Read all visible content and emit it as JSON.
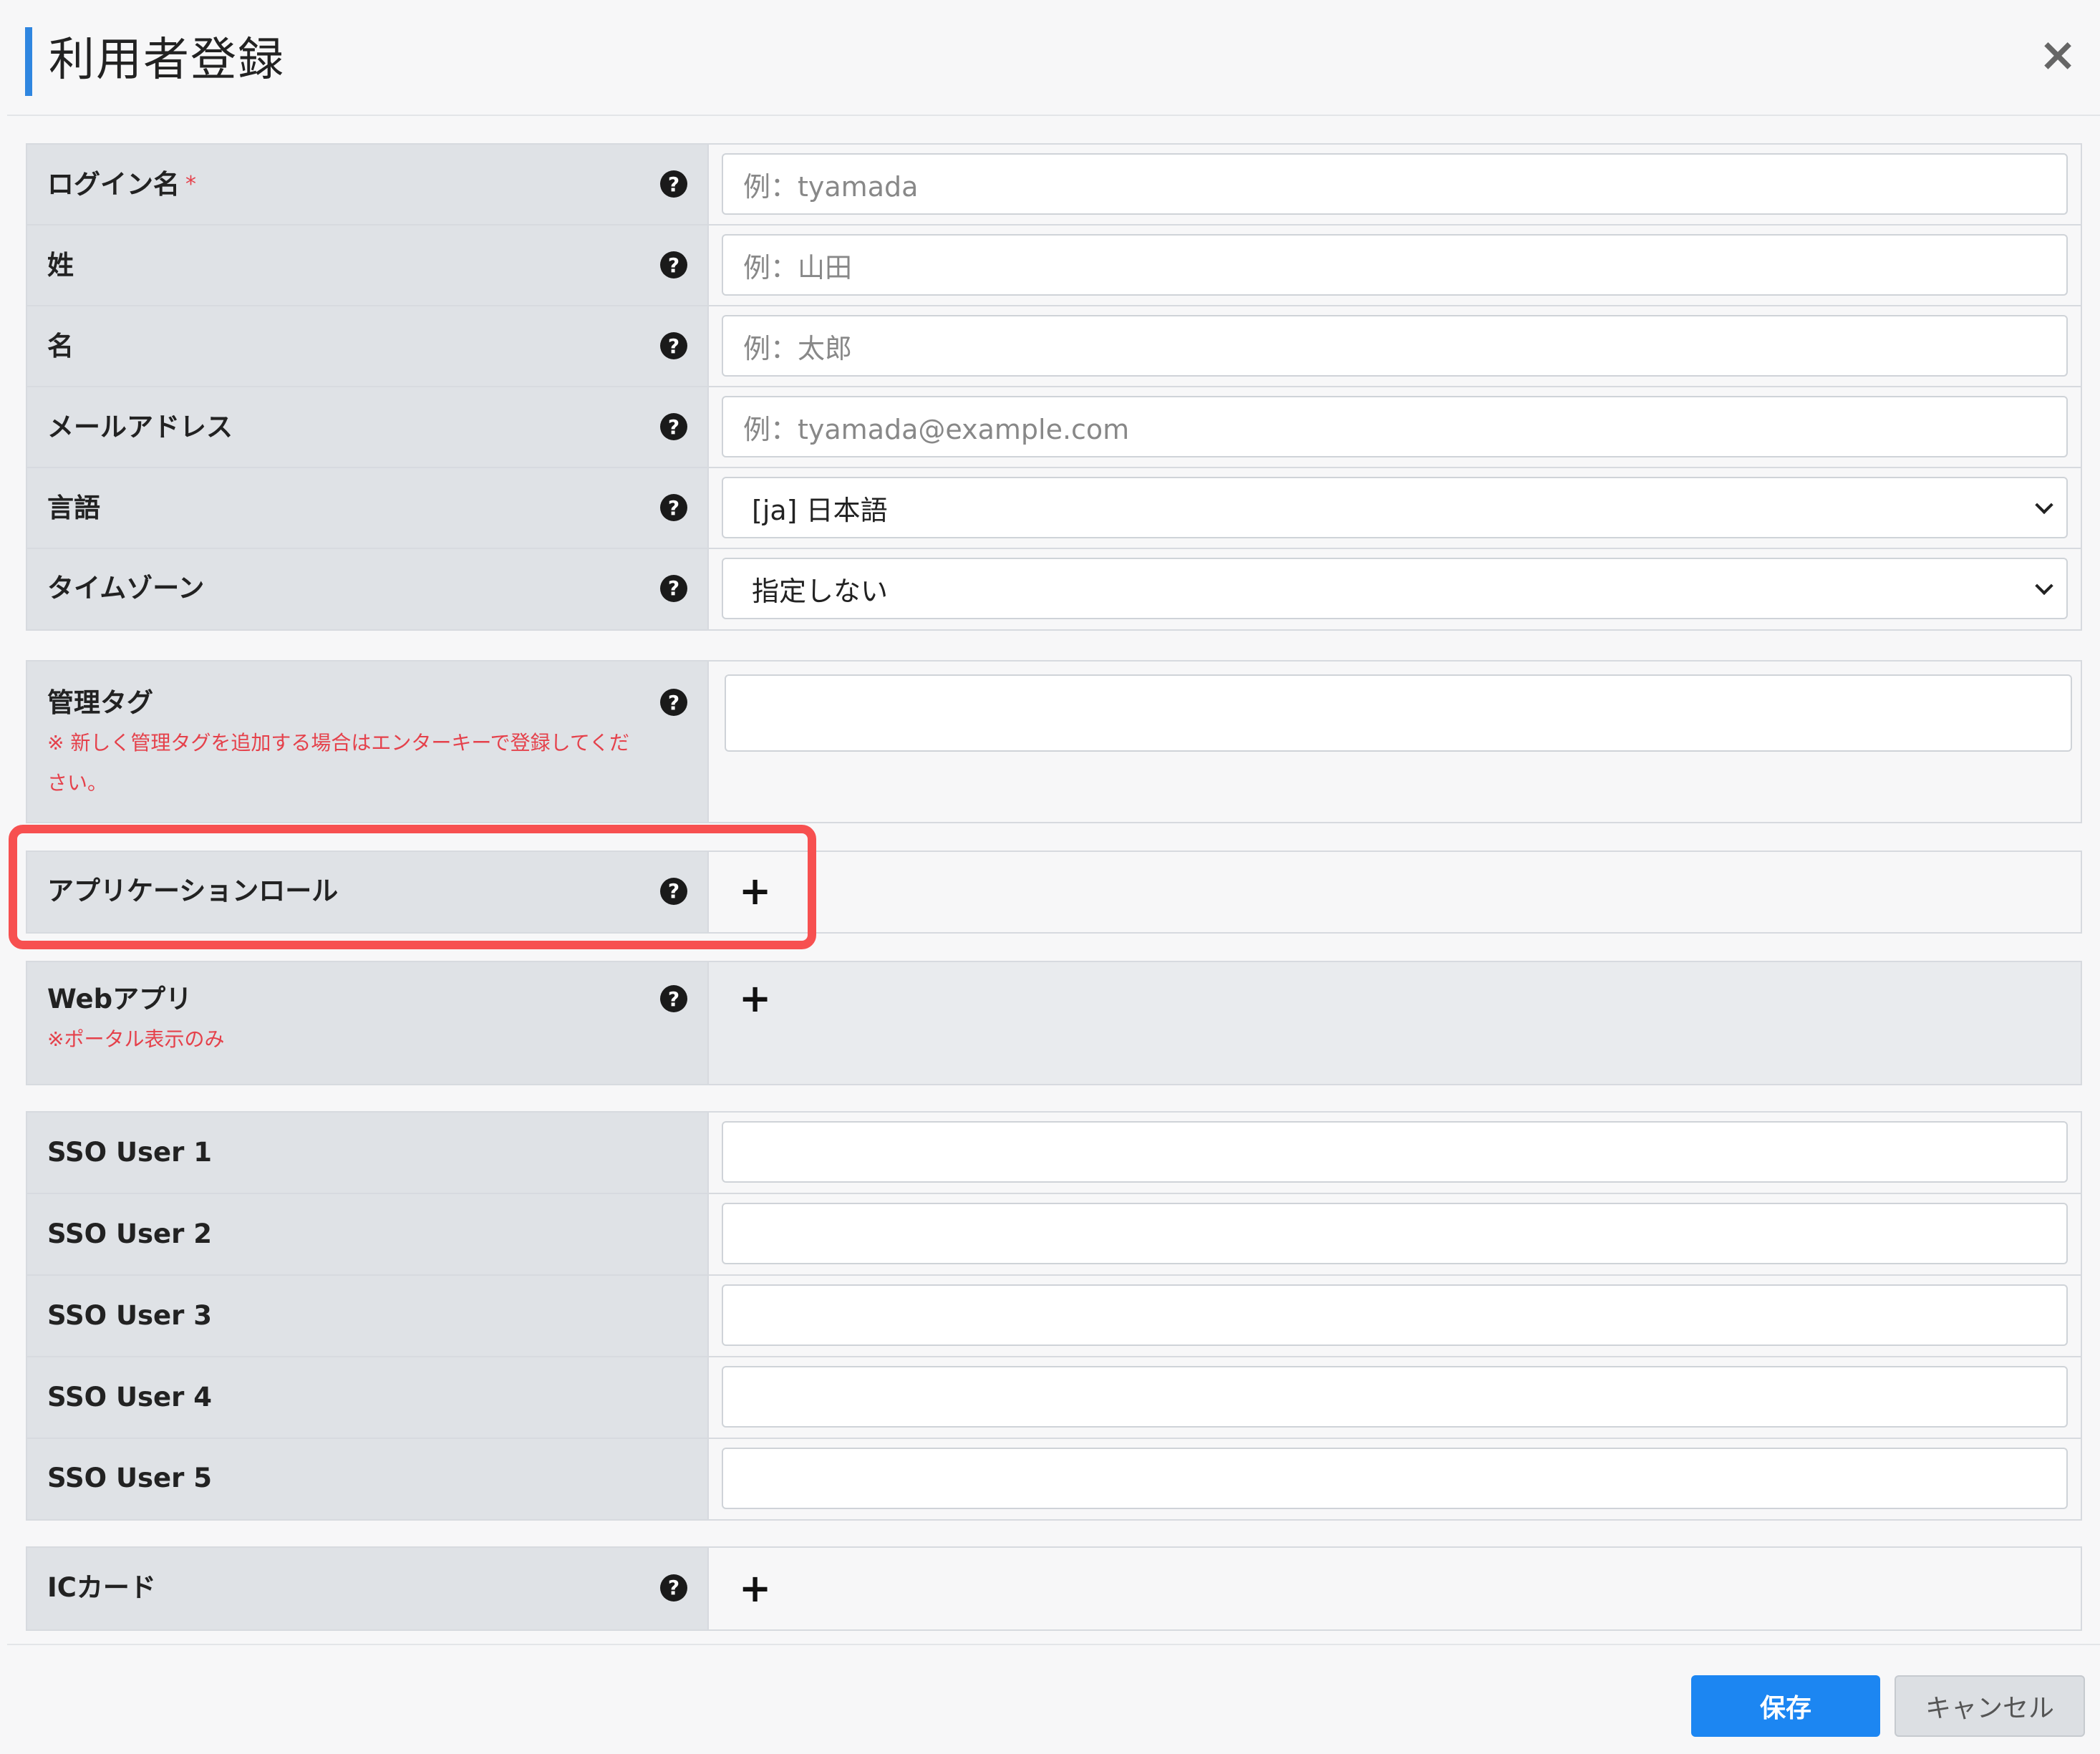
{
  "dialog": {
    "title": "利用者登録",
    "close_label": "×"
  },
  "fields": {
    "login_name": {
      "label": "ログイン名",
      "required": "*",
      "placeholder": "例：tyamada"
    },
    "last_name": {
      "label": "姓",
      "placeholder": "例：山田"
    },
    "first_name": {
      "label": "名",
      "placeholder": "例：太郎"
    },
    "email": {
      "label": "メールアドレス",
      "placeholder": "例：tyamada@example.com"
    },
    "language": {
      "label": "言語",
      "value": "[ja] 日本語"
    },
    "timezone": {
      "label": "タイムゾーン",
      "value": "指定しない"
    },
    "admin_tag": {
      "label": "管理タグ",
      "note_line1": "※ 新しく管理タグを追加する場合はエンターキーで登録してくだ",
      "note_line2": "さい。"
    },
    "app_role": {
      "label": "アプリケーションロール"
    },
    "web_app": {
      "label": "Webアプリ",
      "note": "※ポータル表示のみ"
    },
    "sso_users": [
      "SSO User 1",
      "SSO User 2",
      "SSO User 3",
      "SSO User 4",
      "SSO User 5"
    ],
    "ic_card": {
      "label": "ICカード"
    }
  },
  "icons": {
    "help": "?",
    "add": "+"
  },
  "buttons": {
    "save": "保存",
    "cancel": "キャンセル"
  },
  "colors": {
    "accent": "#2f86e0",
    "primary_button": "#1c86f2",
    "required": "#e5414b",
    "highlight_box": "#f75050"
  }
}
